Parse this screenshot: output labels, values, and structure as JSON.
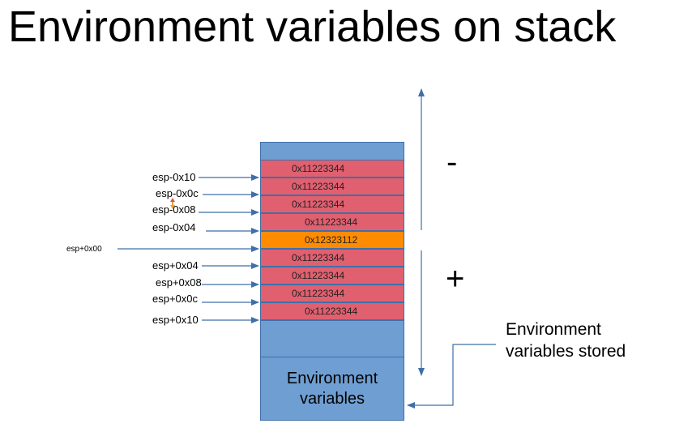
{
  "title": "Environment variables on stack",
  "cells": [
    {
      "value": "0x11223344",
      "color": "#e06070",
      "label": "esp-0x10"
    },
    {
      "value": "0x11223344",
      "color": "#e06070",
      "label": "esp-0x0c"
    },
    {
      "value": "0x11223344",
      "color": "#e06070",
      "label": "esp-0x08"
    },
    {
      "value": "0x11223344",
      "color": "#e06070",
      "label": "esp-0x04"
    },
    {
      "value": "0x12323112",
      "color": "#ff8c00",
      "label": "esp+0x00"
    },
    {
      "value": "0x11223344",
      "color": "#e06070",
      "label": "esp+0x04"
    },
    {
      "value": "0x11223344",
      "color": "#e06070",
      "label": "esp+0x08"
    },
    {
      "value": "0x11223344",
      "color": "#e06070",
      "label": "esp+0x0c"
    },
    {
      "value": "0x11223344",
      "color": "#e06070",
      "label": "esp+0x10"
    }
  ],
  "env_box": {
    "line1": "Environment",
    "line2": "variables"
  },
  "minus_sign": "-",
  "plus_sign": "+",
  "note": {
    "line1": "Environment",
    "line2": "variables stored"
  },
  "colors": {
    "stack_blue": "#6f9fd2",
    "cell_red": "#e06070",
    "cell_orange": "#ff8c00",
    "arrow": "#3f6fa8"
  }
}
